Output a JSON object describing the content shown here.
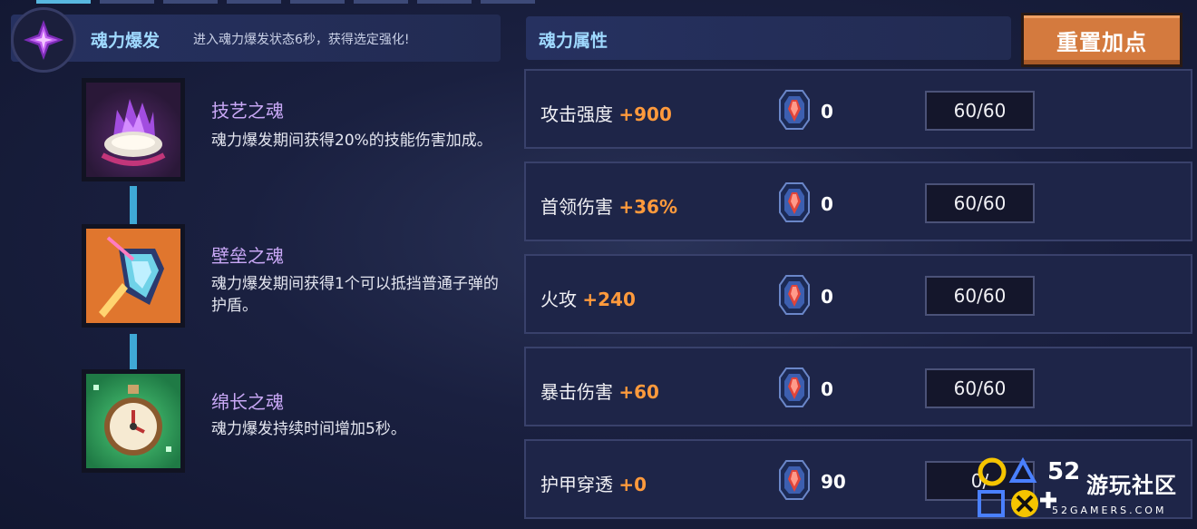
{
  "burst": {
    "title": "魂力爆发",
    "description": "进入魂力爆发状态6秒，获得选定强化!"
  },
  "skills": [
    {
      "name": "技艺之魂",
      "description": "魂力爆发期间获得20%的技能伤害加成。",
      "icon": "purple-flame-shell-icon"
    },
    {
      "name": "壁垒之魂",
      "description": "魂力爆发期间获得1个可以抵挡普通子弹的护盾。",
      "icon": "shield-icon"
    },
    {
      "name": "绵长之魂",
      "description": "魂力爆发持续时间增加5秒。",
      "icon": "stopwatch-icon"
    }
  ],
  "attributes": {
    "title": "魂力属性",
    "reset_label": "重置加点",
    "stats": [
      {
        "label": "攻击强度",
        "bonus": "+900",
        "gems": "0",
        "level": "60/60"
      },
      {
        "label": "首领伤害",
        "bonus": "+36%",
        "gems": "0",
        "level": "60/60"
      },
      {
        "label": "火攻",
        "bonus": "+240",
        "gems": "0",
        "level": "60/60"
      },
      {
        "label": "暴击伤害",
        "bonus": "+60",
        "gems": "0",
        "level": "60/60"
      },
      {
        "label": "护甲穿透",
        "bonus": "+0",
        "gems": "90",
        "level": "0/"
      }
    ]
  },
  "watermark": {
    "number": "52",
    "text": "游玩社区",
    "url": "52GAMERS.COM"
  },
  "colors": {
    "accent_orange": "#ff9a3c",
    "title_blue": "#9fd9ff",
    "skill_name_purple": "#c9a8f6",
    "button_orange": "#d47a3e"
  }
}
